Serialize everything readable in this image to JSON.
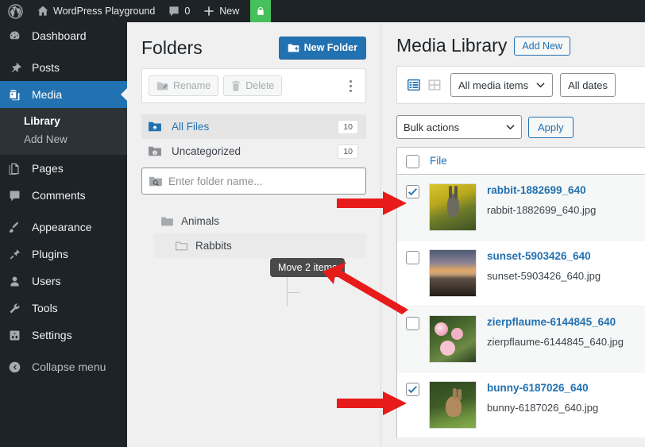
{
  "adminbar": {
    "site_title": "WordPress Playground",
    "comment_count": "0",
    "new_label": "New",
    "wp_logo_icon": "wordpress-logo-icon",
    "home_icon": "home-icon",
    "comment_icon": "comment-bubble-icon",
    "plus_icon": "plus-icon",
    "lock_icon": "lock-icon",
    "lock_color": "#46c05a"
  },
  "sidebar": {
    "items": [
      {
        "label": "Dashboard",
        "icon": "dashboard-icon",
        "active": false
      },
      {
        "label": "Posts",
        "icon": "pin-icon",
        "active": false
      },
      {
        "label": "Media",
        "icon": "media-icon",
        "active": true
      },
      {
        "label": "Pages",
        "icon": "pages-icon",
        "active": false
      },
      {
        "label": "Comments",
        "icon": "comment-bubble-icon",
        "active": false
      },
      {
        "label": "Appearance",
        "icon": "paintbrush-icon",
        "active": false
      },
      {
        "label": "Plugins",
        "icon": "plug-icon",
        "active": false
      },
      {
        "label": "Users",
        "icon": "user-icon",
        "active": false
      },
      {
        "label": "Tools",
        "icon": "wrench-icon",
        "active": false
      },
      {
        "label": "Settings",
        "icon": "settings-icon",
        "active": false
      }
    ],
    "submenu": [
      {
        "label": "Library",
        "current": true
      },
      {
        "label": "Add New",
        "current": false
      }
    ],
    "collapse_label": "Collapse menu",
    "collapse_icon": "collapse-arrow-icon",
    "active_color": "#2271b1",
    "background": "#1d2327"
  },
  "folders": {
    "title": "Folders",
    "new_folder_label": "New Folder",
    "new_folder_icon": "folder-plus-icon",
    "toolbar": {
      "rename_label": "Rename",
      "rename_icon": "folder-pencil-icon",
      "delete_label": "Delete",
      "delete_icon": "trash-icon",
      "more_icon": "vertical-dots-icon"
    },
    "list": [
      {
        "label": "All Files",
        "count": "10",
        "icon": "folder-home-icon",
        "selected": true
      },
      {
        "label": "Uncategorized",
        "count": "10",
        "icon": "folder-info-icon",
        "selected": false
      }
    ],
    "search_placeholder": "Enter folder name...",
    "search_value": "",
    "search_icon": "folder-search-icon",
    "tree": [
      {
        "label": "Animals",
        "icon": "folder-icon",
        "level": 0,
        "highlighted": false
      },
      {
        "label": "Rabbits",
        "icon": "folder-outline-icon",
        "level": 1,
        "highlighted": true
      }
    ],
    "drag_tooltip": "Move 2 items"
  },
  "media": {
    "title": "Media Library",
    "add_new_label": "Add New",
    "view_list_icon": "list-view-icon",
    "view_grid_icon": "grid-view-icon",
    "filter_media_items": "All media items",
    "filter_dates": "All dates",
    "bulk_actions_label": "Bulk actions",
    "apply_label": "Apply",
    "column_file": "File",
    "header_checkbox_checked": false,
    "rows": [
      {
        "title": "rabbit-1882699_640",
        "filename": "rabbit-1882699_640.jpg",
        "checked": true,
        "thumb": "th-rabbit",
        "thumb_name": "thumbnail-rabbit"
      },
      {
        "title": "sunset-5903426_640",
        "filename": "sunset-5903426_640.jpg",
        "checked": false,
        "thumb": "th-sunset",
        "thumb_name": "thumbnail-sunset"
      },
      {
        "title": "zierpflaume-6144845_640",
        "filename": "zierpflaume-6144845_640.jpg",
        "checked": false,
        "thumb": "th-zier",
        "thumb_name": "thumbnail-zierpflaume"
      },
      {
        "title": "bunny-6187026_640",
        "filename": "bunny-6187026_640.jpg",
        "checked": true,
        "thumb": "th-bunny",
        "thumb_name": "thumbnail-bunny"
      }
    ]
  },
  "annotations": {
    "arrow_color": "#e81b1b",
    "arrows": [
      {
        "name": "arrow-to-rabbit-checkbox",
        "direction": "right"
      },
      {
        "name": "arrow-to-move-tooltip",
        "direction": "up-left"
      },
      {
        "name": "arrow-to-bunny-checkbox",
        "direction": "right"
      }
    ]
  }
}
